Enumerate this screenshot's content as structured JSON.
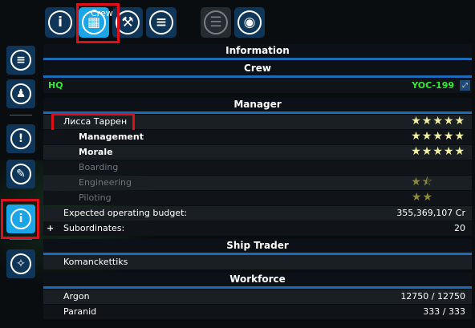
{
  "tabs": [
    {
      "icon": "info-icon",
      "glyph": "i",
      "active": false
    },
    {
      "icon": "crew-icon",
      "glyph": "▦",
      "active": true
    },
    {
      "icon": "wrench-icon",
      "glyph": "⚒",
      "active": false
    },
    {
      "icon": "ship-icon",
      "glyph": "≡",
      "active": false
    },
    {
      "icon": "list-icon",
      "glyph": "☰",
      "active": false
    },
    {
      "icon": "fuel-icon",
      "glyph": "◉",
      "active": false
    }
  ],
  "tooltip": "Crew",
  "sidebar": [
    {
      "icon": "menu-lines-icon",
      "glyph": "≡"
    },
    {
      "icon": "person-icon",
      "glyph": "♟"
    },
    {
      "icon": "alert-icon",
      "glyph": "!"
    },
    {
      "icon": "edit-icon",
      "glyph": "✎"
    },
    {
      "icon": "info-icon",
      "glyph": "i",
      "active": true
    },
    {
      "icon": "compass-icon",
      "glyph": "✧"
    }
  ],
  "sections": {
    "information": "Information",
    "crew": "Crew",
    "manager": "Manager",
    "ship_trader": "Ship Trader",
    "workforce": "Workforce"
  },
  "hq": {
    "label": "HQ",
    "code": "YOC-199"
  },
  "manager": {
    "name": "Лисса Таррен",
    "stars": "★★★★★",
    "skills": [
      {
        "label": "Management",
        "stars": "★★★★★",
        "active": true
      },
      {
        "label": "Morale",
        "stars": "★★★★★",
        "active": true
      },
      {
        "label": "Boarding",
        "stars": "",
        "active": false
      },
      {
        "label": "Engineering",
        "stars": "★⯪",
        "active": false
      },
      {
        "label": "Piloting",
        "stars": "★★",
        "active": false
      }
    ],
    "budget_label": "Expected operating budget:",
    "budget_value": "355,369,107 Cr",
    "subordinates_label": "Subordinates:",
    "subordinates_value": "20"
  },
  "ship_trader": {
    "name": "Komanckettiks"
  },
  "workforce": [
    {
      "race": "Argon",
      "value": "12750 / 12750"
    },
    {
      "race": "Paranid",
      "value": "333 / 333"
    }
  ]
}
